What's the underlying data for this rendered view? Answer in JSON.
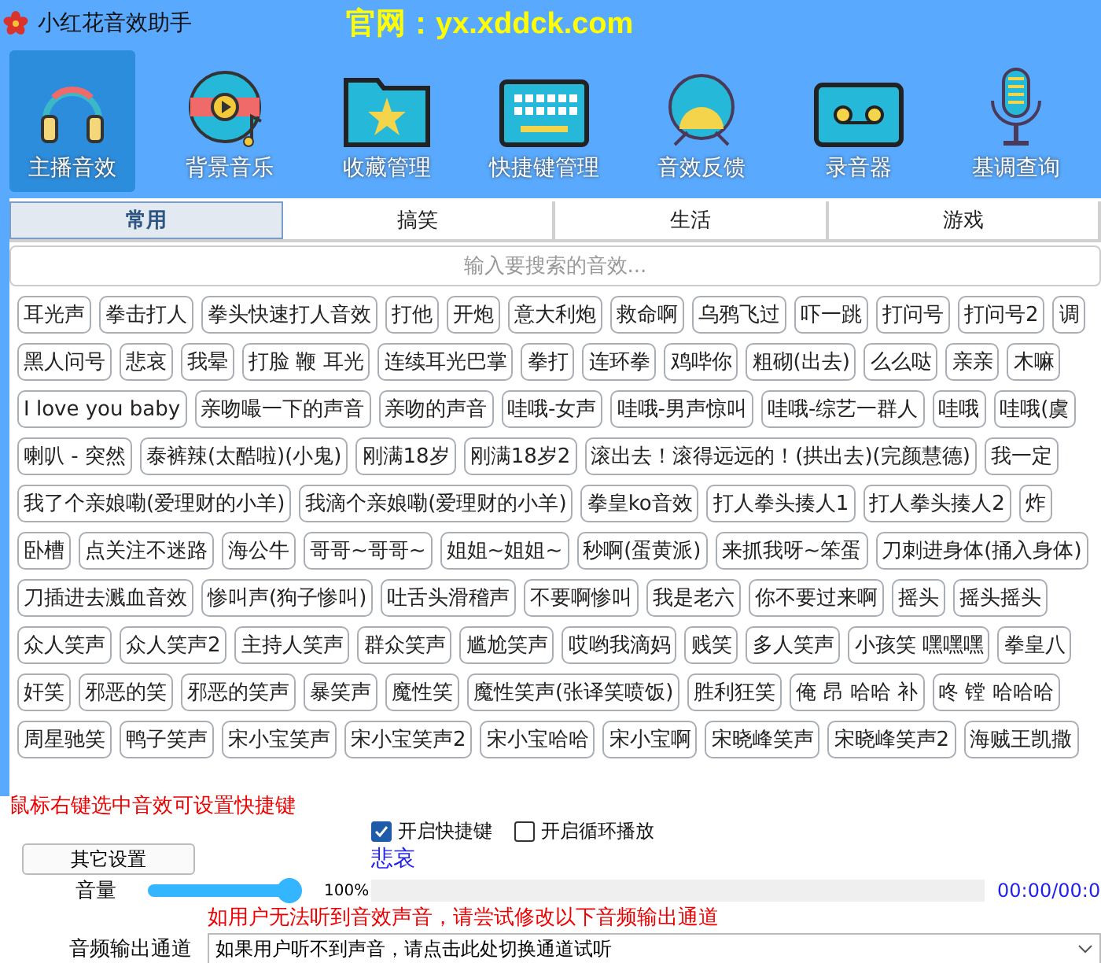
{
  "window": {
    "title": "小红花音效助手",
    "banner": "官网：yx.xddck.com"
  },
  "toolbar": [
    {
      "label": "主播音效",
      "selected": true
    },
    {
      "label": "背景音乐",
      "selected": false
    },
    {
      "label": "收藏管理",
      "selected": false
    },
    {
      "label": "快捷键管理",
      "selected": false
    },
    {
      "label": "音效反馈",
      "selected": false
    },
    {
      "label": "录音器",
      "selected": false
    },
    {
      "label": "基调查询",
      "selected": false
    }
  ],
  "tabs": [
    {
      "label": "常用",
      "selected": true
    },
    {
      "label": "搞笑",
      "selected": false
    },
    {
      "label": "生活",
      "selected": false
    },
    {
      "label": "游戏",
      "selected": false
    }
  ],
  "search": {
    "placeholder": "输入要搜索的音效..."
  },
  "sound_rows": [
    [
      "耳光声",
      "拳击打人",
      "拳头快速打人音效",
      "打他",
      "开炮",
      "意大利炮",
      "救命啊",
      "乌鸦飞过",
      "吓一跳",
      "打问号",
      "打问号2",
      "调"
    ],
    [
      "黑人问号",
      "悲哀",
      "我晕",
      "打脸 鞭 耳光",
      "连续耳光巴掌",
      "拳打",
      "连环拳",
      "鸡哔你",
      "粗砌(出去)",
      "么么哒",
      "亲亲",
      "木嘛"
    ],
    [
      "I love you baby",
      "亲吻嘬一下的声音",
      "亲吻的声音",
      "哇哦-女声",
      "哇哦-男声惊叫",
      "哇哦-综艺一群人",
      "哇哦",
      "哇哦(虞"
    ],
    [
      "喇叭 - 突然",
      "泰裤辣(太酷啦)(小鬼)",
      "刚满18岁",
      "刚满18岁2",
      "滚出去！滚得远远的！(拱出去)(完颜慧德)",
      "我一定"
    ],
    [
      "我了个亲娘嘞(爱理财的小羊)",
      "我滴个亲娘嘞(爱理财的小羊)",
      "拳皇ko音效",
      "打人拳头揍人1",
      "打人拳头揍人2",
      "炸"
    ],
    [
      "卧槽",
      "点关注不迷路",
      "海公牛",
      "哥哥~哥哥~",
      "姐姐~姐姐~",
      "秒啊(蛋黄派)",
      "来抓我呀~笨蛋",
      "刀刺进身体(捅入身体)"
    ],
    [
      "刀插进去溅血音效",
      "惨叫声(狗子惨叫)",
      "吐舌头滑稽声",
      "不要啊惨叫",
      "我是老六",
      "你不要过来啊",
      "摇头",
      "摇头摇头"
    ],
    [
      "众人笑声",
      "众人笑声2",
      "主持人笑声",
      "群众笑声",
      "尴尬笑声",
      "哎哟我滴妈",
      "贱笑",
      "多人笑声",
      "小孩笑 嘿嘿嘿",
      "拳皇八"
    ],
    [
      "奸笑",
      "邪恶的笑",
      "邪恶的笑声",
      "暴笑声",
      "魔性笑",
      "魔性笑声(张译笑喷饭)",
      "胜利狂笑",
      "俺 昂 哈哈 补",
      "咚 镗 哈哈哈"
    ],
    [
      "周星驰笑",
      "鸭子笑声",
      "宋小宝笑声",
      "宋小宝笑声2",
      "宋小宝哈哈",
      "宋小宝啊",
      "宋晓峰笑声",
      "宋晓峰笑声2",
      "海贼王凯撒"
    ]
  ],
  "hint": "鼠标右键选中音效可设置快捷键",
  "options": [
    {
      "label": "开启快捷键",
      "checked": true
    },
    {
      "label": "开启循环播放",
      "checked": false
    }
  ],
  "settings_button": "其它设置",
  "now_playing": "悲哀",
  "volume": {
    "label": "音量",
    "level": 1.0,
    "reading": "100%"
  },
  "playback": {
    "level": 0,
    "time": "00:00/00:0"
  },
  "output_hint": "如用户无法听到音效声音，请尝试修改以下音频输出通道",
  "output": {
    "label": "音频输出通道",
    "value": "如果用户听不到声音，请点击此处切换通道试听"
  }
}
